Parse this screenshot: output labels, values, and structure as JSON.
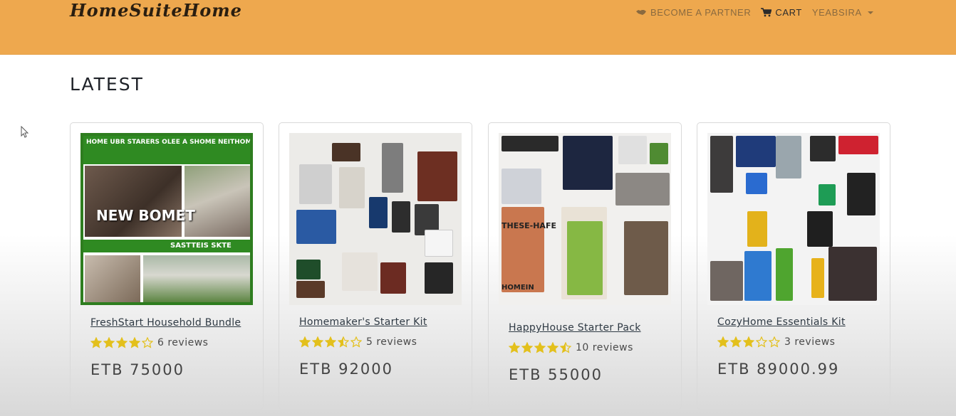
{
  "brand": "HomeSuiteHome",
  "nav": {
    "partner": "BECOME A PARTNER",
    "cart": "CART",
    "user": "YEABSIRA"
  },
  "section_title": "LATEST",
  "products": [
    {
      "title": "FreshStart Household Bundle",
      "rating": 4,
      "reviews": "6 reviews",
      "price": "ETB 75000",
      "image_text": {
        "header": "HOME UBR STARERS OLEE A SHOME NEITHOMRE",
        "center": "NEW BOMET",
        "footer": "SASTTEIS SKTE"
      }
    },
    {
      "title": "Homemaker's Starter Kit",
      "rating": 3.5,
      "reviews": "5 reviews",
      "price": "ETB 92000"
    },
    {
      "title": "HappyHouse Starter Pack",
      "rating": 4.5,
      "reviews": "10 reviews",
      "price": "ETB 55000",
      "image_text": {
        "label1": "THESE-HAFE",
        "label2": "HOMEIN"
      }
    },
    {
      "title": "CozyHome Essentials Kit",
      "rating": 3,
      "reviews": "3 reviews",
      "price": "ETB 89000.99"
    }
  ],
  "colors": {
    "navbar": "#eea84e",
    "star": "#e3c01c",
    "green_band": "#2f8a22"
  },
  "icons": {
    "partner": "handshake-icon",
    "cart": "cart-icon",
    "user_menu": "caret-down-icon"
  }
}
